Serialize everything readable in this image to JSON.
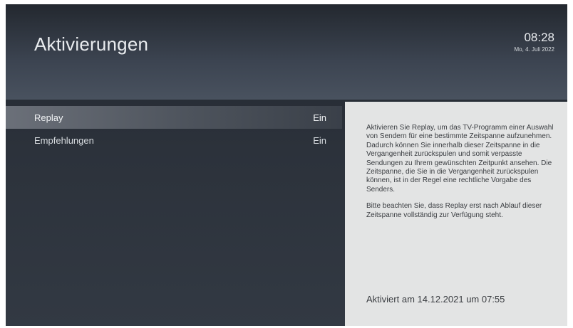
{
  "header": {
    "title": "Aktivierungen",
    "time": "08:28",
    "date": "Mo, 4. Juli 2022"
  },
  "menu": {
    "items": [
      {
        "label": "Replay",
        "value": "Ein",
        "selected": true
      },
      {
        "label": "Empfehlungen",
        "value": "Ein",
        "selected": false
      }
    ]
  },
  "info": {
    "paragraphs": [
      "Aktivieren Sie Replay, um das TV-Programm einer Auswahl von Sendern für eine bestimmte Zeitspanne aufzunehmen. Dadurch können Sie innerhalb dieser Zeitspanne in die Vergangenheit zurückspulen und somit verpasste Sendungen zu Ihrem gewünschten Zeitpunkt ansehen. Die Zeitspanne, die Sie in die Vergangenheit zurückspulen können, ist in der Regel eine rechtliche Vorgabe des Senders.",
      "Bitte beachten Sie, dass Replay erst nach Ablauf  dieser Zeitspanne vollständig zur Verfügung steht."
    ],
    "activated": "Aktiviert am 14.12.2021 um 07:55"
  },
  "colors": {
    "background": "#2c323b",
    "header": "#3c4451",
    "panel": "#e3e4e4",
    "text_light": "#e9ecef",
    "text_dark": "#3a3d41"
  }
}
